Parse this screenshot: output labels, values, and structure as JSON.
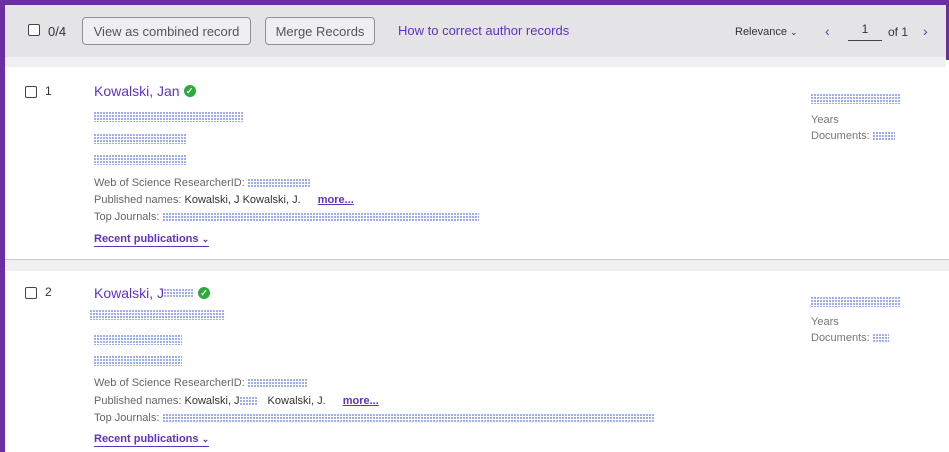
{
  "toolbar": {
    "selected_count": "0/4",
    "view_combined_label": "View as combined record",
    "merge_label": "Merge Records",
    "help_link": "How to correct author records",
    "sort_label": "Relevance",
    "prev_icon": "‹",
    "page_value": "1",
    "of_label": "of 1",
    "next_icon": "›"
  },
  "records": [
    {
      "number": "1",
      "name": "Kowalski, Jan",
      "researcherid_label": "Web of Science ResearcherID:",
      "published_label": "Published names:",
      "published_names": "Kowalski, J   Kowalski, J.",
      "more_label": "more...",
      "journals_label": "Top Journals:",
      "recent_label": "Recent publications",
      "years_label": "Years",
      "documents_label": "Documents:"
    },
    {
      "number": "2",
      "name": "Kowalski, J",
      "researcherid_label": "Web of Science ResearcherID:",
      "published_label": "Published names:",
      "published_names_a": "Kowalski, J",
      "published_names_b": "Kowalski, J.",
      "more_label": "more...",
      "journals_label": "Top Journals:",
      "recent_label": "Recent publications",
      "years_label": "Years",
      "documents_label": "Documents:"
    }
  ],
  "colors": {
    "brand_purple": "#6b2fa0",
    "link_purple": "#5e33bf",
    "verified_green": "#2bab3c"
  },
  "icons": {
    "verified": "verified-check-icon",
    "sort": "chevron-down-icon",
    "recent": "chevron-down-icon"
  }
}
